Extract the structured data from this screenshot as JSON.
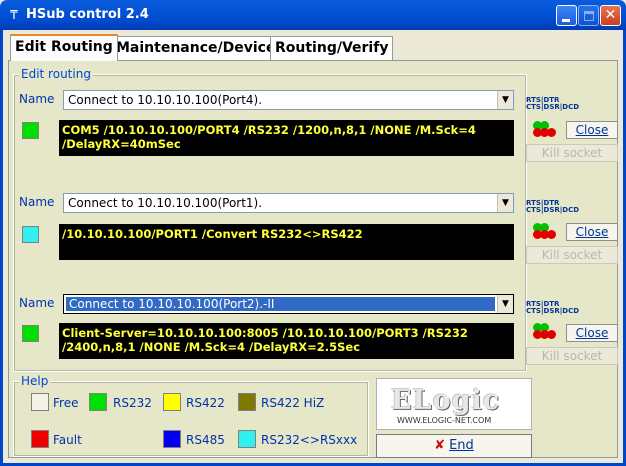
{
  "window": {
    "title": "HSub control 2.4",
    "close_glyph": "✕"
  },
  "tabs": [
    {
      "label": "Edit Routing"
    },
    {
      "label": "Maintenance/Device"
    },
    {
      "label": "Routing/Verify"
    }
  ],
  "edit_group": {
    "label": "Edit routing"
  },
  "name_label": "Name",
  "signal_legend": {
    "line1": "RTS|DTR",
    "line2": "CTS|DSR|DCD"
  },
  "routes": [
    {
      "name": "Connect to 10.10.10.100(Port4).",
      "indicator_color": "#00e000",
      "info_line1": "COM5 /10.10.10.100/PORT4 /RS232 /1200,n,8,1 /NONE /M.Sck=4",
      "info_line2": "/DelayRX=40mSec",
      "close_label": "Close",
      "kill_label": "Kill socket"
    },
    {
      "name": "Connect to 10.10.10.100(Port1).",
      "indicator_color": "#30f0f0",
      "info_line1": "/10.10.10.100/PORT1 /Convert RS232<>RS422",
      "info_line2": "",
      "close_label": "Close",
      "kill_label": "Kill socket"
    },
    {
      "name": "Connect to 10.10.10.100(Port2).-II",
      "indicator_color": "#00e000",
      "info_line1": "Client-Server=10.10.10.100:8005 /10.10.10.100/PORT3 /RS232",
      "info_line2": "/2400,n,8,1 /NONE /M.Sck=4 /DelayRX=2.5Sec",
      "close_label": "Close",
      "kill_label": "Kill socket"
    }
  ],
  "help": {
    "label": "Help",
    "items": [
      {
        "label": "Free",
        "color": "#f2f2e6"
      },
      {
        "label": "RS232",
        "color": "#00e000"
      },
      {
        "label": "RS422",
        "color": "#ffff00"
      },
      {
        "label": "RS422 HiZ",
        "color": "#807800"
      },
      {
        "label": "Fault",
        "color": "#ee0000"
      },
      {
        "label": "RS485",
        "color": "#0000ee"
      },
      {
        "label": "RS232<>RSxxx",
        "color": "#30f0f0"
      }
    ]
  },
  "logo": {
    "word": "ELogic",
    "url": "WWW.ELOGIC-NET.COM"
  },
  "end_button": {
    "icon": "✘",
    "label": "End"
  },
  "colors": {
    "led_green": "#00c000",
    "led_red": "#e00000"
  }
}
